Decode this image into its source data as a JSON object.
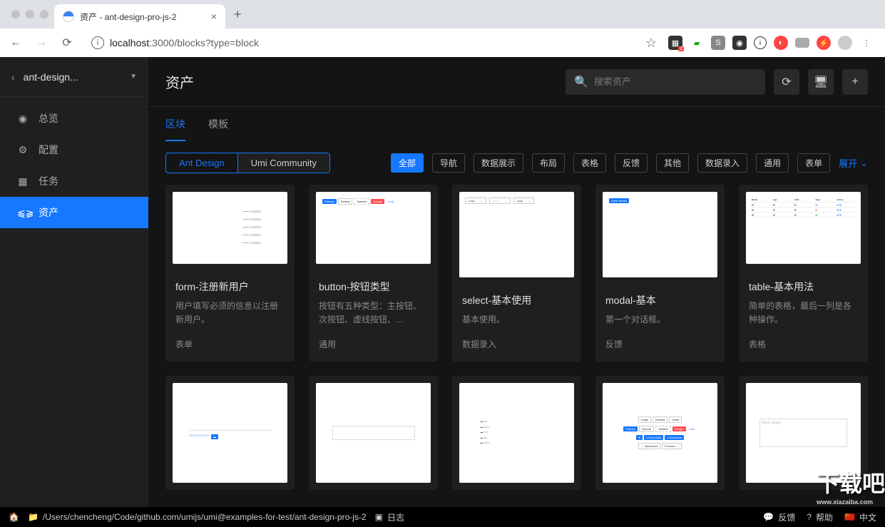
{
  "browser": {
    "tab_title": "资产 - ant-design-pro-js-2",
    "url_host": "localhost",
    "url_port": ":3000",
    "url_path": "/blocks?type=block"
  },
  "sidebar": {
    "project": "ant-design...",
    "items": [
      {
        "icon": "◉",
        "label": "总览"
      },
      {
        "icon": "⚙",
        "label": "配置"
      },
      {
        "icon": "▦",
        "label": "任务"
      },
      {
        "icon": "⫹⫺",
        "label": "资产"
      }
    ]
  },
  "header": {
    "title": "资产",
    "search_placeholder": "搜索资产"
  },
  "tabs": [
    {
      "label": "区块",
      "active": true
    },
    {
      "label": "模板",
      "active": false
    }
  ],
  "sources": [
    {
      "label": "Ant Design",
      "active": true
    },
    {
      "label": "Umi Community",
      "active": false
    }
  ],
  "tags": [
    {
      "label": "全部",
      "active": true
    },
    {
      "label": "导航"
    },
    {
      "label": "数据展示"
    },
    {
      "label": "布局"
    },
    {
      "label": "表格"
    },
    {
      "label": "反馈"
    },
    {
      "label": "其他"
    },
    {
      "label": "数据录入"
    },
    {
      "label": "通用"
    },
    {
      "label": "表单"
    }
  ],
  "expand_label": "展开",
  "cards": [
    {
      "title": "form-注册新用户",
      "desc": "用户填写必须的信息以注册新用户。",
      "tag": "表单",
      "thumb": "form"
    },
    {
      "title": "button-按钮类型",
      "desc": "按钮有五种类型：主按钮、次按钮、虚线按钮、...",
      "tag": "通用",
      "thumb": "buttons"
    },
    {
      "title": "select-基本使用",
      "desc": "基本使用。",
      "tag": "数据录入",
      "thumb": "select"
    },
    {
      "title": "modal-基本",
      "desc": "第一个对话框。",
      "tag": "反馈",
      "thumb": "modal"
    },
    {
      "title": "table-基本用法",
      "desc": "简单的表格，最后一列是各种操作。",
      "tag": "表格",
      "thumb": "table"
    },
    {
      "title": "",
      "desc": "",
      "tag": "",
      "thumb": "partial1"
    },
    {
      "title": "",
      "desc": "",
      "tag": "",
      "thumb": "partial2"
    },
    {
      "title": "",
      "desc": "",
      "tag": "",
      "thumb": "partial3"
    },
    {
      "title": "",
      "desc": "",
      "tag": "",
      "thumb": "partial4"
    },
    {
      "title": "",
      "desc": "",
      "tag": "",
      "thumb": "partial5"
    }
  ],
  "status": {
    "path": "/Users/chencheng/Code/github.com/umijs/umi@examples-for-test/ant-design-pro-js-2",
    "log": "日志",
    "feedback": "反馈",
    "help": "帮助",
    "lang": "中文"
  },
  "watermark": {
    "big": "下载吧",
    "small": "www.xiazaiba.com"
  }
}
